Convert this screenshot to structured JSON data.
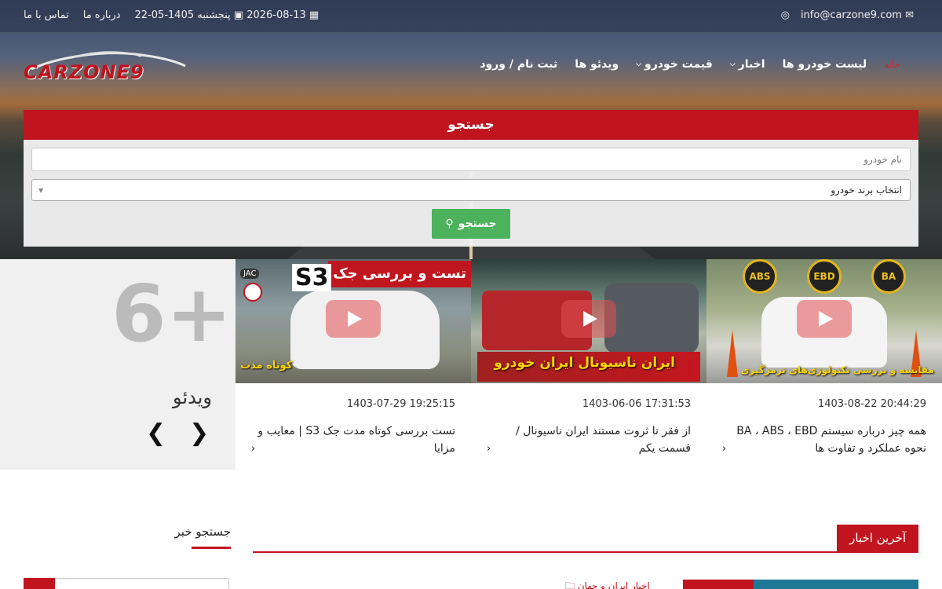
{
  "topbar": {
    "email": "info@carzone9.com",
    "date_gregorian": "2026-08-13",
    "day_name": "پنجشنبه",
    "date_jalali": "1405-05-22",
    "about": "درباره ما",
    "contact": "تماس با ما"
  },
  "logo": {
    "text": "CARZONE9"
  },
  "nav": {
    "home": "خانه",
    "cars_list": "لیست خودرو ها",
    "news": "اخبار",
    "price": "قیمت خودرو",
    "videos": "ویدئو ها",
    "login": "ثبت نام / ورود"
  },
  "search": {
    "title": "جستجو",
    "name_placeholder": "نام خودرو",
    "brand_selected": "انتخاب برند خودرو",
    "button": "جستجو"
  },
  "videos_panel": {
    "count": "6+",
    "label": "ویدئو"
  },
  "videos": [
    {
      "date": "1403-08-22 20:44:29",
      "title": "همه چیز درباره سیستم BA ، ABS ، EBD نحوه عملکرد و تفاوت ها",
      "thumb_text": "مقایسه و بررسی تکنولوژی‌های ترمزگیری",
      "badges": [
        "BA",
        "EBD",
        "ABS"
      ]
    },
    {
      "date": "1403-06-06 17:31:53",
      "title": "از فقر تا ثروت مستند ایران ناسیونال / قسمت یکم",
      "thumb_text": "ایران ناسیونال ایران خودرو"
    },
    {
      "date": "1403-07-29 19:25:15",
      "title": "تست بررسی کوتاه مدت جک S3 | معایب و مزایا",
      "thumb_banner": "تست و بررسی جک",
      "thumb_model": "S3",
      "thumb_text": "کوتاه مدت",
      "thumb_logo": "JAC"
    }
  ],
  "news": {
    "latest_title": "آخرین اخبار",
    "search_title": "جستجو خبر",
    "category": "اخبار ایران و جهان"
  },
  "colors": {
    "brand_red": "#c0141f",
    "green": "#4cb25c",
    "blue": "#1f7896"
  }
}
